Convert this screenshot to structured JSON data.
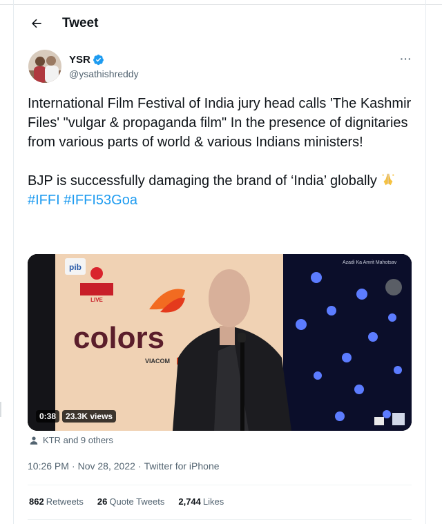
{
  "header": {
    "title": "Tweet"
  },
  "author": {
    "display_name": "YSR",
    "handle": "@ysathishreddy",
    "verified": true
  },
  "more_label": "···",
  "tweet": {
    "paragraph1": "International Film Festival of India jury head calls 'The Kashmir Files' \"vulgar & propaganda film\" In the presence of dignitaries from various parts of world & various Indians ministers!",
    "paragraph2": "BJP is successfully damaging the brand of ‘India’ globally",
    "hashtag1": "#IFFI",
    "hashtag2": "#IFFI53Goa"
  },
  "video": {
    "duration": "0:38",
    "views": "23.3K views",
    "screen_logo": "colors",
    "screen_sub": "VIACOM",
    "pib_logo": "pib",
    "channel_live": "LIVE",
    "azadi_text": "Azadi Ka Amrit Mahotsav"
  },
  "likers": "KTR and 9 others",
  "meta": {
    "time": "10:26 PM",
    "date": "Nov 28, 2022",
    "source": "Twitter for iPhone"
  },
  "stats": {
    "retweets_count": "862",
    "retweets_label": "Retweets",
    "quotes_count": "26",
    "quotes_label": "Quote Tweets",
    "likes_count": "2,744",
    "likes_label": "Likes"
  },
  "colors": {
    "accent": "#1d9bf0",
    "secondary_text": "#536471",
    "primary_text": "#0f1419"
  },
  "icons": {
    "back": "arrow-left-icon",
    "verified": "verified-badge-icon",
    "more": "more-dots-icon",
    "likers": "person-icon",
    "emoji": "folded-hands-emoji"
  }
}
